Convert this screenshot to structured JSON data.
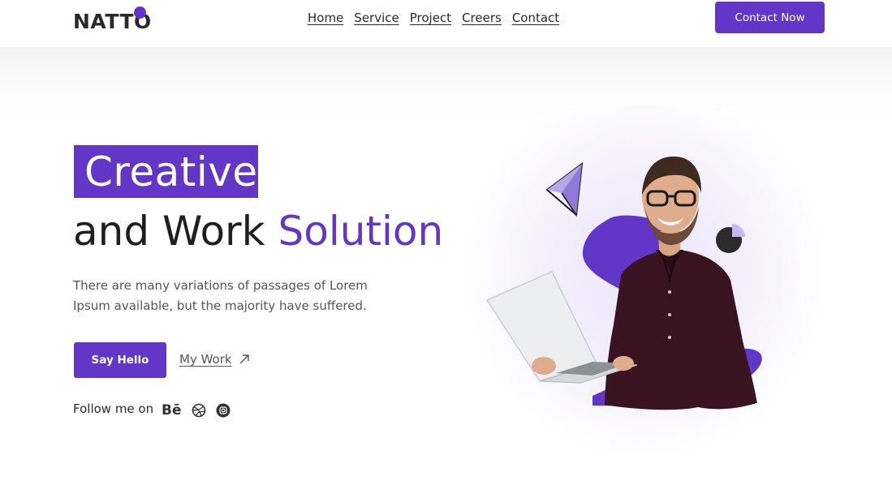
{
  "header": {
    "logo_text": "NATTO",
    "nav": [
      "Home",
      "Service",
      "Project",
      "Creers",
      "Contact"
    ],
    "cta_label": "Contact Now"
  },
  "hero": {
    "badge_word": "Creative",
    "line2_prefix": "and Work",
    "line2_accent": "Solution",
    "description": "There are many variations of passages of Lorem Ipsum available, but the majority have suffered.",
    "primary_button": "Say Hello",
    "secondary_link": "My Work",
    "follow_label": "Follow me on",
    "socials": [
      "behance-icon",
      "dribbble-icon",
      "instagram-icon"
    ],
    "social_be_glyph": "Bē"
  },
  "colors": {
    "accent": "#6236c6",
    "text_dark": "#1f1f1f",
    "text_muted": "#555555"
  },
  "illustration": {
    "subject": "man-with-laptop-photo",
    "decor": [
      "paper-plane-icon",
      "pie-chart-icon",
      "purple-blob"
    ]
  }
}
